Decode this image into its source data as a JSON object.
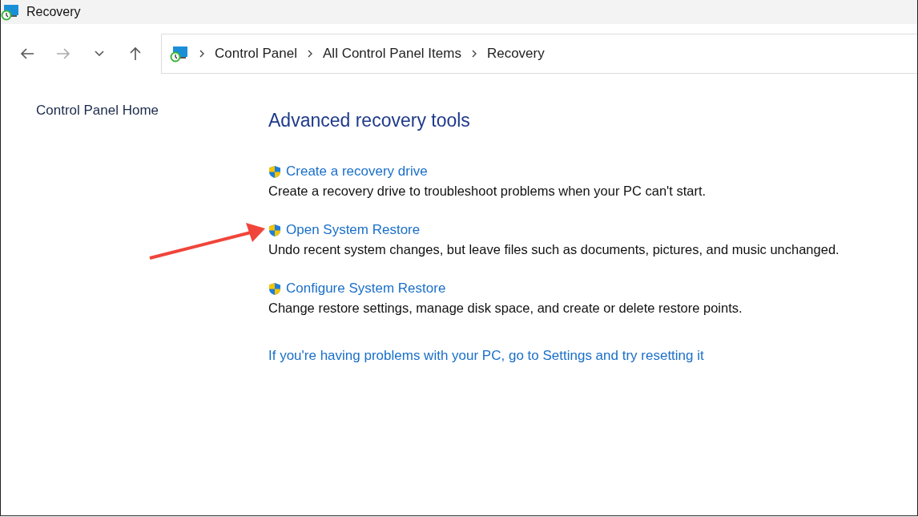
{
  "window": {
    "title": "Recovery"
  },
  "nav": [
    {
      "kind": "back",
      "disabled": false
    },
    {
      "kind": "forward",
      "disabled": true
    },
    {
      "kind": "recent",
      "disabled": false
    },
    {
      "kind": "up",
      "disabled": false
    }
  ],
  "breadcrumb": [
    "Control Panel",
    "All Control Panel Items",
    "Recovery"
  ],
  "sidebar": {
    "items": [
      "Control Panel Home"
    ]
  },
  "main": {
    "heading": "Advanced recovery tools",
    "tasks": [
      {
        "link": "Create a recovery drive",
        "description": "Create a recovery drive to troubleshoot problems when your PC can't start."
      },
      {
        "link": "Open System Restore",
        "description": "Undo recent system changes, but leave files such as documents, pictures, and music unchanged."
      },
      {
        "link": "Configure System Restore",
        "description": "Change restore settings, manage disk space, and create or delete restore points."
      }
    ],
    "footer_link": "If you're having problems with your PC, go to Settings and try resetting it"
  }
}
